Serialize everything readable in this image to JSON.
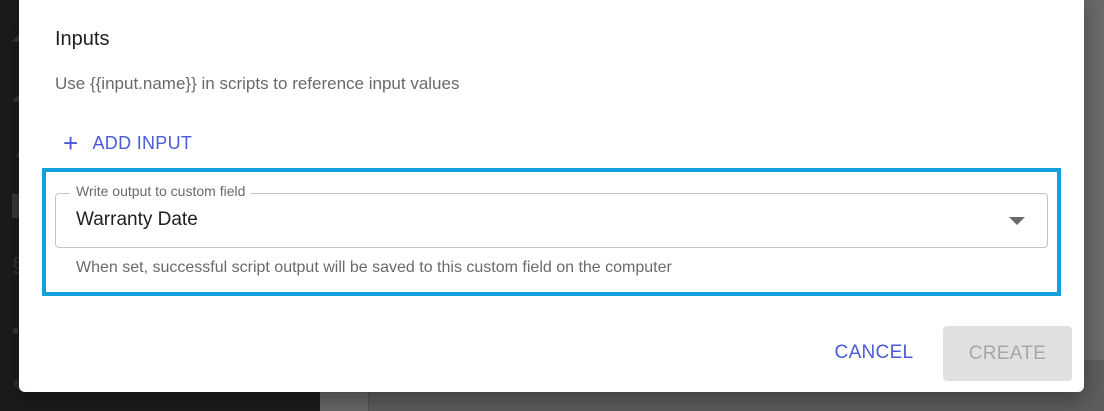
{
  "inputs_section": {
    "title": "Inputs",
    "help_text": "Use {{input.name}} in scripts to reference input values",
    "add_input_label": "ADD INPUT"
  },
  "output_field": {
    "label": "Write output to custom field",
    "value": "Warranty Date",
    "helper_text": "When set, successful script output will be saved to this custom field on the computer"
  },
  "actions": {
    "cancel_label": "CANCEL",
    "create_label": "CREATE"
  },
  "colors": {
    "accent": "#4b5bd6",
    "highlight": "#14a0dd",
    "disabled_bg": "#e0e0e0",
    "disabled_text": "#a6a6a6"
  },
  "icons": {
    "add": "plus-icon",
    "dropdown": "chevron-down-icon"
  }
}
